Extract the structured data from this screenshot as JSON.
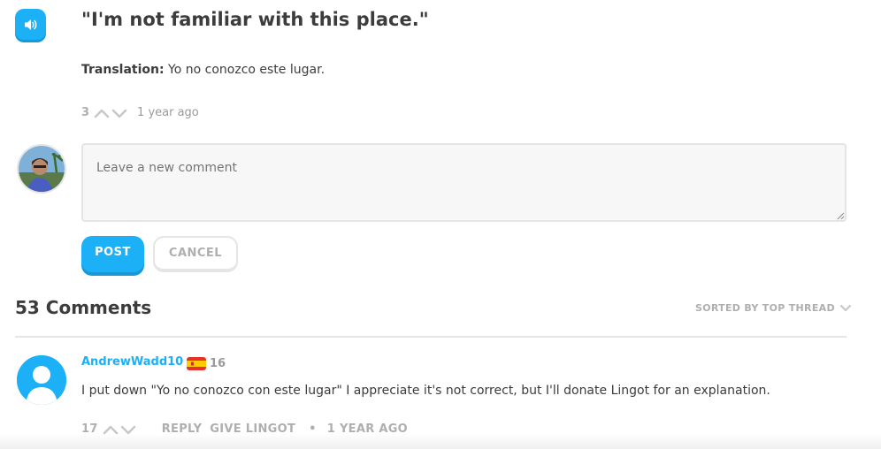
{
  "header": {
    "speaker_icon": "speaker-icon",
    "sentence": "\"I'm not familiar with this place.\"",
    "translation_label": "Translation:",
    "translation_text": " Yo no conozco este lugar."
  },
  "sentence_meta": {
    "votes": "3",
    "age": "1 year ago"
  },
  "new_comment": {
    "placeholder": "Leave a new comment",
    "post_label": "POST",
    "cancel_label": "CANCEL"
  },
  "comments_header": {
    "count_label": "53 Comments",
    "sort_label": "SORTED BY TOP THREAD"
  },
  "comments": [
    {
      "username": "AndrewWadd10",
      "flag": "spain-flag-icon",
      "level": "16",
      "text": "I put down \"Yo no conozco con este lugar\" I appreciate it's not correct, but I'll donate Lingot for an explanation.",
      "votes": "17",
      "reply_label": "REPLY",
      "lingot_label": "GIVE LINGOT",
      "separator": "•",
      "age": "1 YEAR AGO"
    }
  ],
  "colors": {
    "accent": "#1cb0f6",
    "text": "#3c3c3c",
    "muted": "#afafaf",
    "border": "#e5e5e5"
  }
}
